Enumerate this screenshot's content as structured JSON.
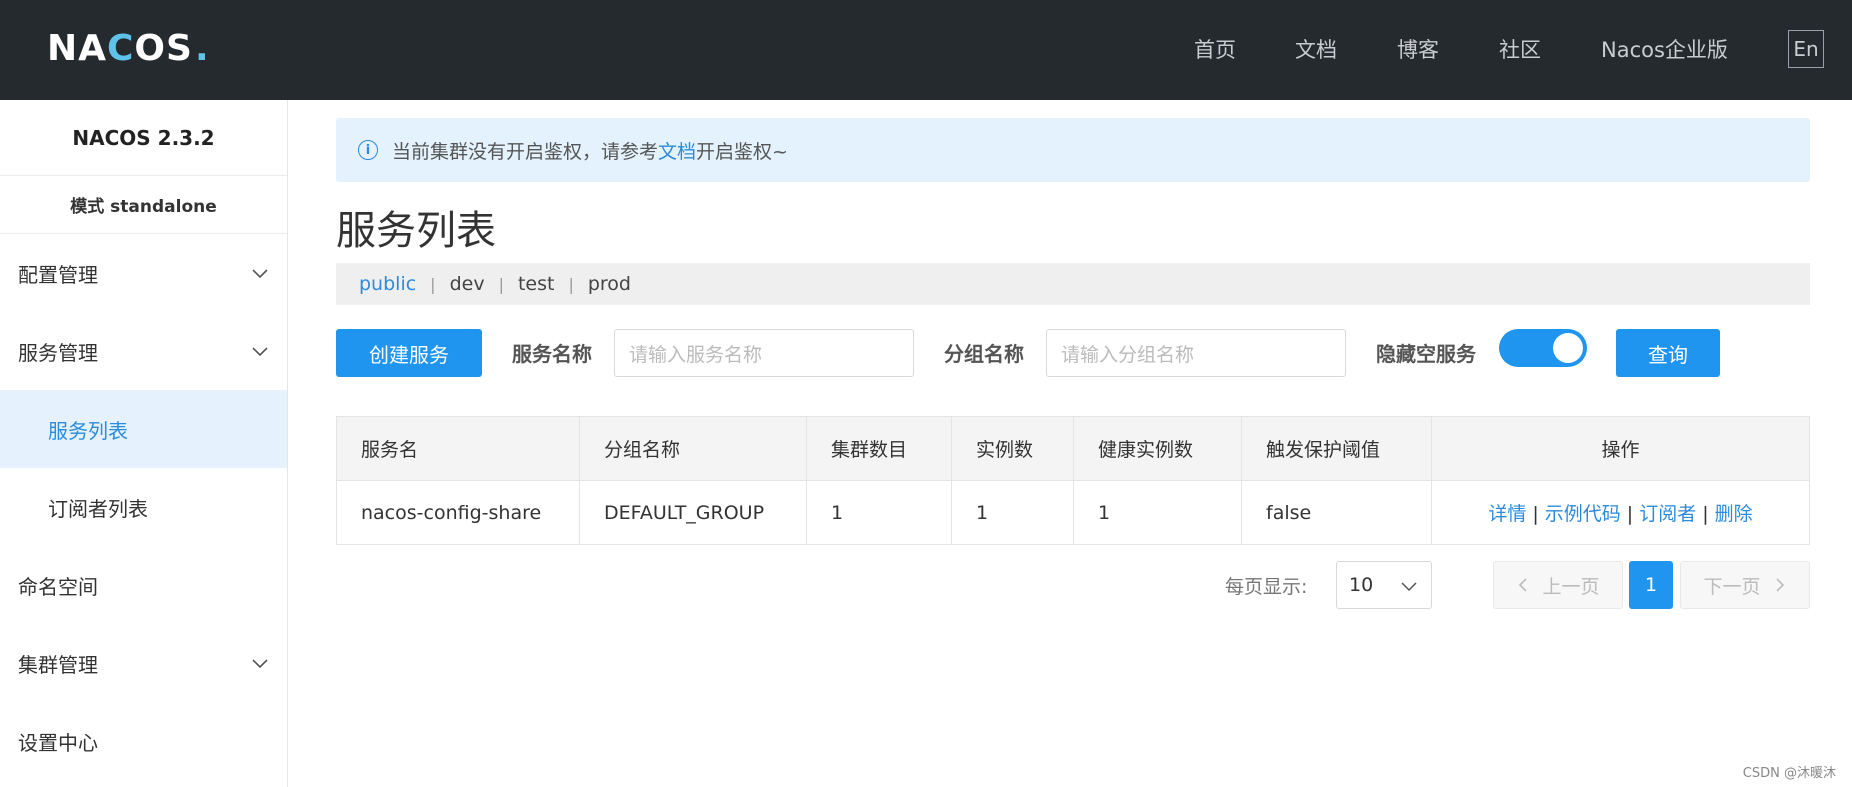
{
  "header": {
    "logo": {
      "part1": "NA",
      "part2": "C",
      "part3": "OS",
      "dot": "."
    },
    "nav": [
      "首页",
      "文档",
      "博客",
      "社区",
      "Nacos企业版"
    ],
    "lang": "En"
  },
  "sidebar": {
    "version": "NACOS 2.3.2",
    "mode": "模式 standalone",
    "items": [
      {
        "label": "配置管理",
        "level": 1,
        "expandable": true
      },
      {
        "label": "服务管理",
        "level": 1,
        "expandable": true
      },
      {
        "label": "服务列表",
        "level": 2,
        "active": true
      },
      {
        "label": "订阅者列表",
        "level": 2
      },
      {
        "label": "命名空间",
        "level": 1
      },
      {
        "label": "集群管理",
        "level": 1,
        "expandable": true
      },
      {
        "label": "设置中心",
        "level": 1
      }
    ]
  },
  "alert": {
    "before": "当前集群没有开启鉴权，请参考",
    "link": "文档",
    "after": "开启鉴权~"
  },
  "page_title": "服务列表",
  "namespaces": [
    "public",
    "dev",
    "test",
    "prod"
  ],
  "filters": {
    "create_button": "创建服务",
    "service_name_label": "服务名称",
    "service_name_placeholder": "请输入服务名称",
    "group_name_label": "分组名称",
    "group_name_placeholder": "请输入分组名称",
    "hide_empty_label": "隐藏空服务",
    "hide_empty_on": true,
    "query_button": "查询"
  },
  "table": {
    "headers": [
      "服务名",
      "分组名称",
      "集群数目",
      "实例数",
      "健康实例数",
      "触发保护阈值",
      "操作"
    ],
    "rows": [
      {
        "service": "nacos-config-share",
        "group": "DEFAULT_GROUP",
        "clusters": "1",
        "instances": "1",
        "healthy": "1",
        "threshold": "false",
        "actions": [
          "详情",
          "示例代码",
          "订阅者",
          "删除"
        ]
      }
    ]
  },
  "pagination": {
    "per_page_label": "每页显示:",
    "per_page": "10",
    "prev": "上一页",
    "current": "1",
    "next": "下一页"
  },
  "watermark": "CSDN @沐暖沐",
  "colors": {
    "accent": "#1f95f0",
    "header_bg": "#252a2f",
    "link": "#2a8bdf"
  }
}
